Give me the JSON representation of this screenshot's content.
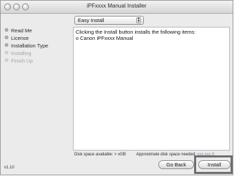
{
  "window": {
    "title": "iPFxxxx Manual Installer"
  },
  "install_type_popup": {
    "selected": "Easy Install",
    "arrows": "▲▼"
  },
  "sidebar": {
    "steps": [
      {
        "label": "Read Me",
        "state": "done"
      },
      {
        "label": "License",
        "state": "done"
      },
      {
        "label": "Installation Type",
        "state": "current"
      },
      {
        "label": "Installing",
        "state": "pending"
      },
      {
        "label": "Finish Up",
        "state": "pending"
      }
    ]
  },
  "content": {
    "lines": [
      "Clicking the Install button installs the following items:",
      "o Canon iPFxxxx Manual"
    ]
  },
  "disk_info": {
    "available_label": "Disk space available:",
    "available_value": "> xGB",
    "needed_label": "Approximate disk space needed:",
    "needed_value": "xxx.xxx K"
  },
  "version": "v1.10",
  "buttons": {
    "go_back": "Go Back",
    "install": "Install"
  },
  "colors": {
    "window_bg": "#ebebeb",
    "dim_text": "#a4a4a4",
    "disk_value": "#7a8fb5",
    "highlight_frame": "#6e6e6e"
  }
}
